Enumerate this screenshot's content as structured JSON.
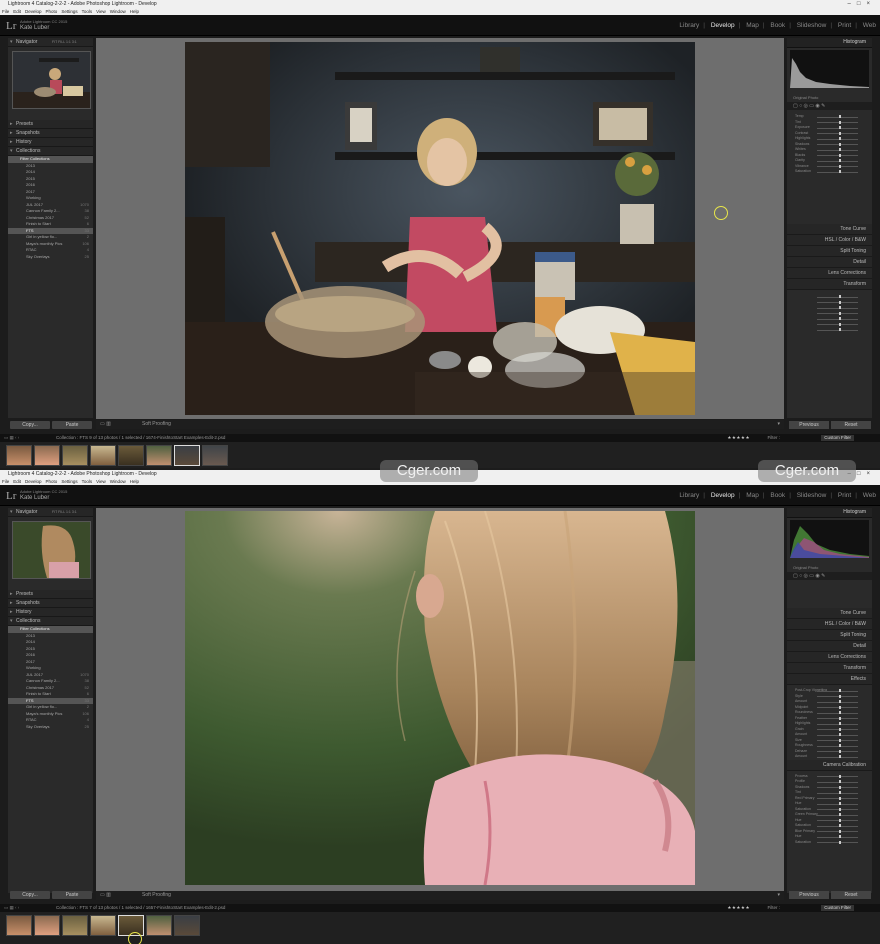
{
  "top": {
    "title": "Lightroom 4 Catalog-2-2-2 - Adobe Photoshop Lightroom - Develop",
    "menu": [
      "File",
      "Edit",
      "Develop",
      "Photo",
      "Settings",
      "Tools",
      "View",
      "Window",
      "Help"
    ],
    "catalog_label": "Adobe Lightroom CC 2015",
    "owner": "Kate Luber",
    "modules": [
      "Library",
      "Develop",
      "Map",
      "Book",
      "Slideshow",
      "Print",
      "Web"
    ],
    "active_module": "Develop",
    "left_panels": [
      "Navigator",
      "Presets",
      "Snapshots",
      "History",
      "Collections"
    ],
    "navigator_modes": "FIT   FILL   1:1   3:1",
    "collections": [
      {
        "label": "Filter Collections",
        "count": "",
        "sub": false,
        "sel": true
      },
      {
        "label": "2013",
        "count": "",
        "sub": true
      },
      {
        "label": "2014",
        "count": "",
        "sub": true
      },
      {
        "label": "2015",
        "count": "",
        "sub": true
      },
      {
        "label": "2016",
        "count": "",
        "sub": true
      },
      {
        "label": "2017",
        "count": "",
        "sub": true
      },
      {
        "label": "Working",
        "count": "",
        "sub": true
      },
      {
        "label": "JUL 2017",
        "count": "1070",
        "sub": true
      },
      {
        "label": "Cannon Family 2...",
        "count": "38",
        "sub": true
      },
      {
        "label": "Christmas 2017",
        "count": "52",
        "sub": true
      },
      {
        "label": "Finish to Start",
        "count": "6",
        "sub": true
      },
      {
        "label": "FTS",
        "count": "33",
        "sub": true,
        "sel": true
      },
      {
        "label": "Girl in yellow flo...",
        "count": "2",
        "sub": true
      },
      {
        "label": "Maya's monthly Pics",
        "count": "106",
        "sub": true
      },
      {
        "label": "RTAC",
        "count": "4",
        "sub": true
      },
      {
        "label": "Sky Overlays",
        "count": "25",
        "sub": true
      }
    ],
    "copy_label": "Copy...",
    "paste_label": "Paste",
    "soft_proofing": "Soft Proofing",
    "histogram_label": "Histogram",
    "original_photo": "Original Photo",
    "right_sections": [
      "Tone Curve",
      "HSL / Color / B&W",
      "Split Toning",
      "Detail",
      "Lens Corrections",
      "Transform"
    ],
    "basic_rows": [
      "Temp",
      "Tint",
      "Exposure",
      "Contrast",
      "Highlights",
      "Shadows",
      "Whites",
      "Blacks",
      "Clarity",
      "Vibrance",
      "Saturation"
    ],
    "previous_label": "Previous",
    "reset_label": "Reset",
    "filmstrip_source": "Collection : FTS     9 of 13 photos / 1 selected / 1674-FinishtoStart Examples-Edit-2.psd",
    "filter_label": "Filter :",
    "custom_filter": "Custom Filter",
    "stars": "★★★★★"
  },
  "bottom": {
    "title": "Lightroom 4 Catalog-2-2-2 - Adobe Photoshop Lightroom - Develop",
    "filmstrip_source": "Collection : FTS     7 of 13 photos / 1 selected / 1657-FinishtoStart Examples-Edit-2.psd",
    "right_sections": [
      "Tone Curve",
      "HSL / Color / B&W",
      "Split Toning",
      "Detail",
      "Lens Corrections",
      "Transform",
      "Effects",
      "Camera Calibration"
    ],
    "effects_rows": [
      "Post-Crop Vignetting",
      "Style",
      "Amount",
      "Midpoint",
      "Roundness",
      "Feather",
      "Highlights",
      "Grain",
      "Amount",
      "Size",
      "Roughness",
      "Dehaze",
      "Amount"
    ],
    "effects_style": "Highlight Priority",
    "calib_rows": [
      "Process",
      "Profile",
      "Shadows",
      "Tint",
      "Red Primary",
      "Hue",
      "Saturation",
      "Green Primary",
      "Hue",
      "Saturation",
      "Blue Primary",
      "Hue",
      "Saturation"
    ],
    "calib_process": "2012 (Current)",
    "calib_profile": "Embedded"
  },
  "watermark": "Cger.com",
  "colors": {
    "accent": "#e8e64a",
    "panel": "#2a2a2a",
    "center": "#6e6e6e"
  }
}
